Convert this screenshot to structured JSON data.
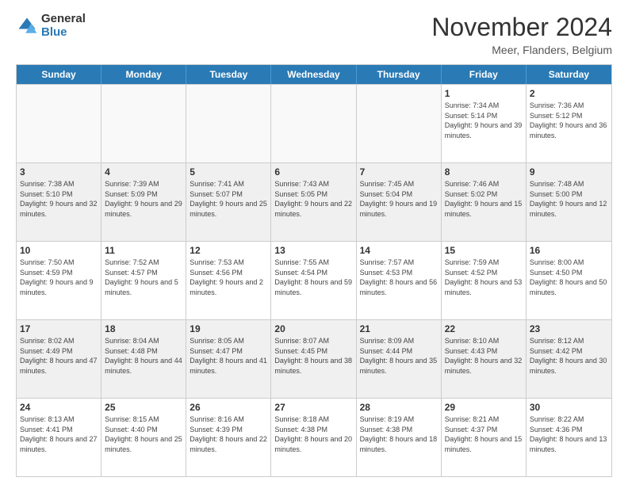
{
  "logo": {
    "general": "General",
    "blue": "Blue"
  },
  "header": {
    "month": "November 2024",
    "location": "Meer, Flanders, Belgium"
  },
  "weekdays": [
    "Sunday",
    "Monday",
    "Tuesday",
    "Wednesday",
    "Thursday",
    "Friday",
    "Saturday"
  ],
  "weeks": [
    [
      {
        "day": "",
        "info": ""
      },
      {
        "day": "",
        "info": ""
      },
      {
        "day": "",
        "info": ""
      },
      {
        "day": "",
        "info": ""
      },
      {
        "day": "",
        "info": ""
      },
      {
        "day": "1",
        "info": "Sunrise: 7:34 AM\nSunset: 5:14 PM\nDaylight: 9 hours and 39 minutes."
      },
      {
        "day": "2",
        "info": "Sunrise: 7:36 AM\nSunset: 5:12 PM\nDaylight: 9 hours and 36 minutes."
      }
    ],
    [
      {
        "day": "3",
        "info": "Sunrise: 7:38 AM\nSunset: 5:10 PM\nDaylight: 9 hours and 32 minutes."
      },
      {
        "day": "4",
        "info": "Sunrise: 7:39 AM\nSunset: 5:09 PM\nDaylight: 9 hours and 29 minutes."
      },
      {
        "day": "5",
        "info": "Sunrise: 7:41 AM\nSunset: 5:07 PM\nDaylight: 9 hours and 25 minutes."
      },
      {
        "day": "6",
        "info": "Sunrise: 7:43 AM\nSunset: 5:05 PM\nDaylight: 9 hours and 22 minutes."
      },
      {
        "day": "7",
        "info": "Sunrise: 7:45 AM\nSunset: 5:04 PM\nDaylight: 9 hours and 19 minutes."
      },
      {
        "day": "8",
        "info": "Sunrise: 7:46 AM\nSunset: 5:02 PM\nDaylight: 9 hours and 15 minutes."
      },
      {
        "day": "9",
        "info": "Sunrise: 7:48 AM\nSunset: 5:00 PM\nDaylight: 9 hours and 12 minutes."
      }
    ],
    [
      {
        "day": "10",
        "info": "Sunrise: 7:50 AM\nSunset: 4:59 PM\nDaylight: 9 hours and 9 minutes."
      },
      {
        "day": "11",
        "info": "Sunrise: 7:52 AM\nSunset: 4:57 PM\nDaylight: 9 hours and 5 minutes."
      },
      {
        "day": "12",
        "info": "Sunrise: 7:53 AM\nSunset: 4:56 PM\nDaylight: 9 hours and 2 minutes."
      },
      {
        "day": "13",
        "info": "Sunrise: 7:55 AM\nSunset: 4:54 PM\nDaylight: 8 hours and 59 minutes."
      },
      {
        "day": "14",
        "info": "Sunrise: 7:57 AM\nSunset: 4:53 PM\nDaylight: 8 hours and 56 minutes."
      },
      {
        "day": "15",
        "info": "Sunrise: 7:59 AM\nSunset: 4:52 PM\nDaylight: 8 hours and 53 minutes."
      },
      {
        "day": "16",
        "info": "Sunrise: 8:00 AM\nSunset: 4:50 PM\nDaylight: 8 hours and 50 minutes."
      }
    ],
    [
      {
        "day": "17",
        "info": "Sunrise: 8:02 AM\nSunset: 4:49 PM\nDaylight: 8 hours and 47 minutes."
      },
      {
        "day": "18",
        "info": "Sunrise: 8:04 AM\nSunset: 4:48 PM\nDaylight: 8 hours and 44 minutes."
      },
      {
        "day": "19",
        "info": "Sunrise: 8:05 AM\nSunset: 4:47 PM\nDaylight: 8 hours and 41 minutes."
      },
      {
        "day": "20",
        "info": "Sunrise: 8:07 AM\nSunset: 4:45 PM\nDaylight: 8 hours and 38 minutes."
      },
      {
        "day": "21",
        "info": "Sunrise: 8:09 AM\nSunset: 4:44 PM\nDaylight: 8 hours and 35 minutes."
      },
      {
        "day": "22",
        "info": "Sunrise: 8:10 AM\nSunset: 4:43 PM\nDaylight: 8 hours and 32 minutes."
      },
      {
        "day": "23",
        "info": "Sunrise: 8:12 AM\nSunset: 4:42 PM\nDaylight: 8 hours and 30 minutes."
      }
    ],
    [
      {
        "day": "24",
        "info": "Sunrise: 8:13 AM\nSunset: 4:41 PM\nDaylight: 8 hours and 27 minutes."
      },
      {
        "day": "25",
        "info": "Sunrise: 8:15 AM\nSunset: 4:40 PM\nDaylight: 8 hours and 25 minutes."
      },
      {
        "day": "26",
        "info": "Sunrise: 8:16 AM\nSunset: 4:39 PM\nDaylight: 8 hours and 22 minutes."
      },
      {
        "day": "27",
        "info": "Sunrise: 8:18 AM\nSunset: 4:38 PM\nDaylight: 8 hours and 20 minutes."
      },
      {
        "day": "28",
        "info": "Sunrise: 8:19 AM\nSunset: 4:38 PM\nDaylight: 8 hours and 18 minutes."
      },
      {
        "day": "29",
        "info": "Sunrise: 8:21 AM\nSunset: 4:37 PM\nDaylight: 8 hours and 15 minutes."
      },
      {
        "day": "30",
        "info": "Sunrise: 8:22 AM\nSunset: 4:36 PM\nDaylight: 8 hours and 13 minutes."
      }
    ]
  ]
}
